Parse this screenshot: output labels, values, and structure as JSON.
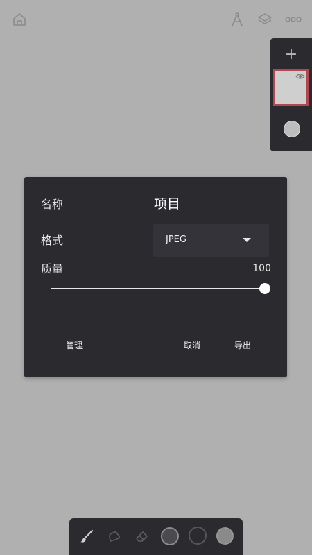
{
  "top_bar": {
    "home_icon": "home-icon",
    "ruler_icon": "ruler-compass-icon",
    "layers_icon": "layers-icon",
    "more_icon": "more-icon"
  },
  "layers_panel": {
    "add_label": "+",
    "selected_border_color": "#b0464f",
    "layer_thumb_color": "#cfcfcf",
    "color_swatch": "#bdbdbd"
  },
  "dialog": {
    "name_label": "名称",
    "name_value": "项目",
    "format_label": "格式",
    "format_value": "JPEG",
    "quality_label": "质量",
    "quality_value": "100",
    "quality_fraction": 1.0,
    "manage_label": "管理",
    "cancel_label": "取消",
    "export_label": "导出"
  },
  "toolbar": {
    "tools": [
      "brush-icon",
      "smudge-icon",
      "eraser-icon",
      "brush-size-icon",
      "opacity-icon",
      "color-icon"
    ]
  },
  "colors": {
    "background": "#b0b0b0",
    "panel": "#2b2a2f",
    "accent_border": "#b0464f"
  }
}
